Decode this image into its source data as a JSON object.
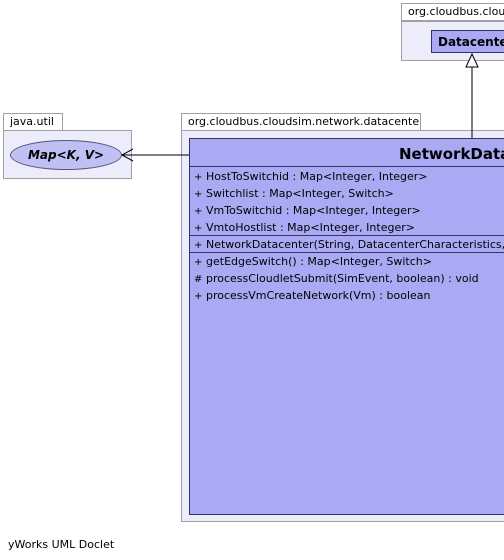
{
  "packages": {
    "top_right": {
      "name": "org.cloudbus.clou"
    },
    "java_util": {
      "name": "java.util"
    },
    "network_datacenter": {
      "name": "org.cloudbus.cloudsim.network.datacenter"
    }
  },
  "classes": {
    "datacenter": {
      "name": "Datacenter"
    },
    "map": {
      "name": "Map<K, V>"
    },
    "network_datacenter": {
      "name": "NetworkDatac",
      "fields": [
        {
          "visibility": "+",
          "text": "HostToSwitchid : Map<Integer, Integer>"
        },
        {
          "visibility": "+",
          "text": "Switchlist : Map<Integer, Switch>"
        },
        {
          "visibility": "+",
          "text": "VmToSwitchid : Map<Integer, Integer>"
        },
        {
          "visibility": "+",
          "text": "VmtoHostlist : Map<Integer, Integer>"
        }
      ],
      "constructors": [
        {
          "visibility": "+",
          "text": "NetworkDatacenter(String, DatacenterCharacteristics, V"
        }
      ],
      "methods": [
        {
          "visibility": "+",
          "text": "getEdgeSwitch() : Map<Integer, Switch>"
        },
        {
          "visibility": "#",
          "text": "processCloudletSubmit(SimEvent, boolean) : void"
        },
        {
          "visibility": "+",
          "text": "processVmCreateNetwork(Vm) : boolean"
        }
      ]
    }
  },
  "footer": "yWorks UML Doclet"
}
